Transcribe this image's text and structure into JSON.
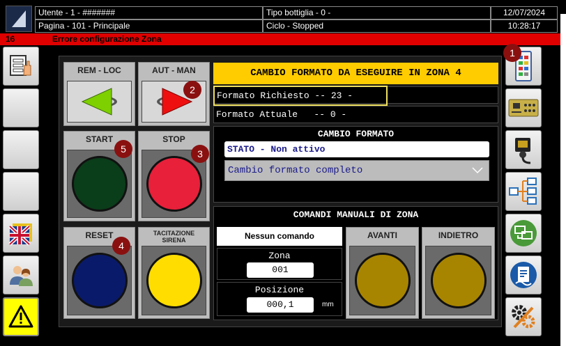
{
  "header": {
    "user": "Utente - 1 - #######",
    "bottle_type": "Tipo bottiglia - 0 -",
    "date": "12/07/2024",
    "page": "Pagina - 101 - Principale",
    "cycle": "Ciclo - Stopped",
    "time": "10:28:17"
  },
  "alarm": {
    "code": "16",
    "message": "Errore configurazione Zona"
  },
  "buttons": {
    "rem_loc": "REM - LOC",
    "aut_man": "AUT - MAN",
    "start": "START",
    "stop": "STOP",
    "reset": "RESET",
    "tacitazione": "TACITAZIONE SIRENA"
  },
  "badges": [
    "1",
    "2",
    "3",
    "4",
    "5"
  ],
  "cambio_header": "CAMBIO FORMATO DA ESEGUIRE IN ZONA 4",
  "formato_richiesto": "Formato Richiesto -- 23 -",
  "formato_attuale": "Formato Attuale   -- 0 -",
  "cambio_formato": {
    "title": "CAMBIO FORMATO",
    "stato": "STATO - Non attivo",
    "selected": "Cambio formato completo"
  },
  "comandi": {
    "title": "COMANDI MANUALI DI ZONA",
    "nessun": "Nessun comando",
    "zona_label": "Zona",
    "zona_value": "001",
    "posizione_label": "Posizione",
    "posizione_value": "000,1",
    "unit": "mm",
    "avanti": "AVANTI",
    "indietro": "INDIETRO"
  },
  "colors": {
    "alarm_red": "#e00000",
    "start_green": "#0a3d1a",
    "stop_red": "#e8203a",
    "reset_blue": "#0a1a6a",
    "siren_yellow": "#ffdd00",
    "manual_amber": "#a88500",
    "header_yellow": "#ffcc00"
  },
  "sidebar_left_icons": [
    "hand-menu-icon",
    "",
    "",
    "",
    "uk-flag-icon",
    "users-icon",
    "warning-icon"
  ],
  "sidebar_right_icons": [
    "led-panel-icon",
    "circuit-board-icon",
    "sensor-icon",
    "tree-network-icon",
    "network-computers-icon",
    "document-icon",
    "gears-icon"
  ]
}
